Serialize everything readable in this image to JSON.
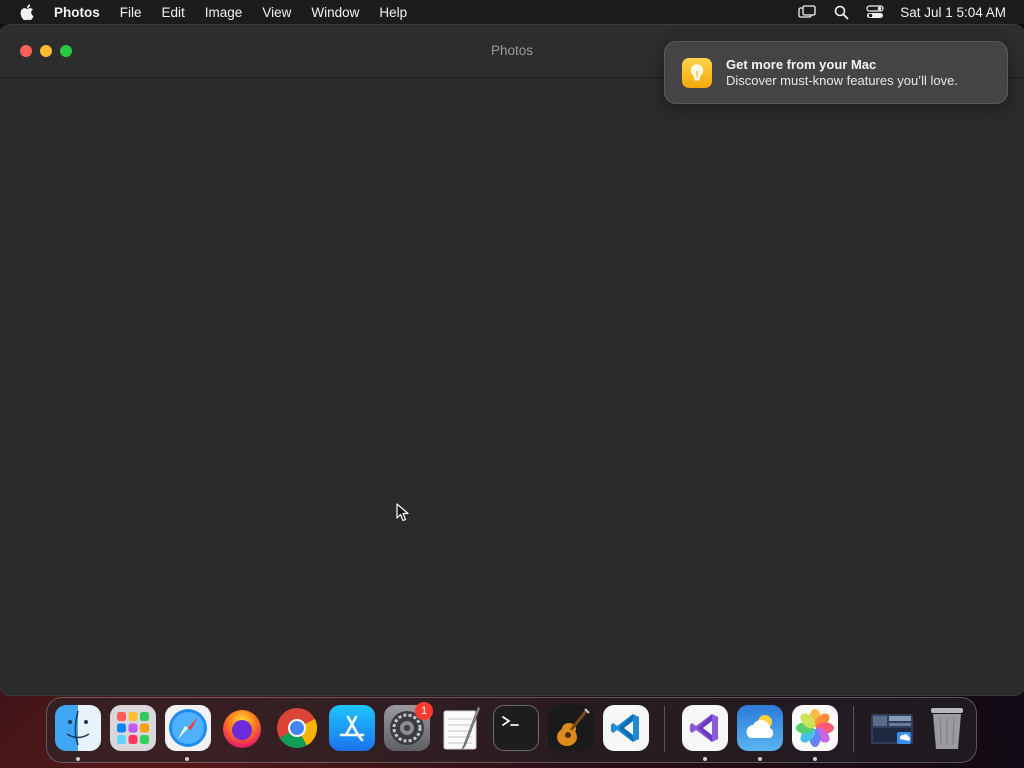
{
  "menubar": {
    "app_name": "Photos",
    "items": [
      "File",
      "Edit",
      "Image",
      "View",
      "Window",
      "Help"
    ],
    "status_icons": [
      "screen-mirroring-icon",
      "spotlight-search-icon",
      "control-center-icon"
    ],
    "clock": "Sat Jul 1  5:04 AM"
  },
  "window": {
    "title": "Photos"
  },
  "notification": {
    "title": "Get more from your Mac",
    "body": "Discover must-know features you’ll love.",
    "icon": "tips-lightbulb-icon"
  },
  "dock": {
    "apps": [
      {
        "name": "Finder",
        "icon": "finder-icon",
        "running": true
      },
      {
        "name": "Launchpad",
        "icon": "launchpad-icon",
        "running": false
      },
      {
        "name": "Safari",
        "icon": "safari-icon",
        "running": true
      },
      {
        "name": "Firefox",
        "icon": "firefox-icon",
        "running": false
      },
      {
        "name": "Chrome",
        "icon": "chrome-icon",
        "running": false
      },
      {
        "name": "App Store",
        "icon": "app-store-icon",
        "running": false
      },
      {
        "name": "System Settings",
        "icon": "system-settings-icon",
        "running": false,
        "badge": "1"
      },
      {
        "name": "TextEdit",
        "icon": "textedit-icon",
        "running": false
      },
      {
        "name": "Terminal",
        "icon": "terminal-icon",
        "running": false
      },
      {
        "name": "GarageBand",
        "icon": "garageband-icon",
        "running": false
      },
      {
        "name": "Visual Studio Code",
        "icon": "vscode-icon",
        "running": false
      },
      {
        "name": "Visual Studio",
        "icon": "visual-studio-icon",
        "running": true
      },
      {
        "name": "Weather",
        "icon": "weather-icon",
        "running": true
      },
      {
        "name": "Photos",
        "icon": "photos-icon",
        "running": true
      },
      {
        "name": "Downloads",
        "icon": "downloads-folder-icon",
        "running": false
      },
      {
        "name": "Trash",
        "icon": "trash-icon",
        "running": false
      }
    ]
  },
  "colors": {
    "close": "#fe5f57",
    "minimize": "#febc2e",
    "zoom": "#28c840",
    "badge": "#ff3b30"
  }
}
